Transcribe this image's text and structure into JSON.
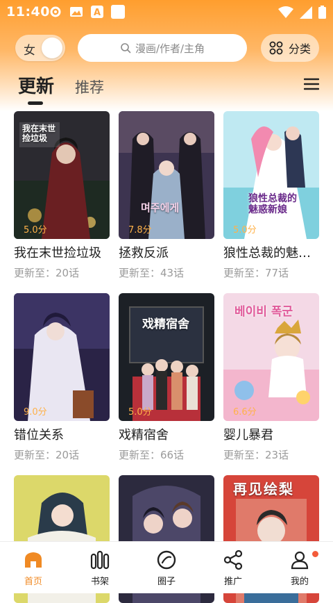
{
  "status_bar": {
    "time": "11:40",
    "icons": [
      "gear-icon",
      "image-icon",
      "a-letter-icon",
      "square-icon"
    ],
    "right_icons": [
      "wifi-icon",
      "cellular-icon",
      "battery-icon"
    ]
  },
  "header": {
    "gender_toggle_label": "女",
    "search_placeholder": "漫画/作者/主角",
    "category_label": "分类",
    "accent_color": "#ff9e2e"
  },
  "tabs": [
    {
      "label": "更新",
      "active": true
    },
    {
      "label": "推荐",
      "active": false
    }
  ],
  "comics": [
    {
      "title": "我在末世捡垃圾",
      "score": "5.0分",
      "update": "更新至：20话",
      "cover_text": "我在末世捡垃圾"
    },
    {
      "title": "拯救反派",
      "score": "7.8分",
      "update": "更新至：43话",
      "cover_text": "며주에게"
    },
    {
      "title": "狼性总裁的魅…",
      "score": "5.0分",
      "update": "更新至：77话",
      "cover_text": "狼性总裁的魅惑新娘"
    },
    {
      "title": "错位关系",
      "score": "9.0分",
      "update": "更新至：20话",
      "cover_text": ""
    },
    {
      "title": "戏精宿舍",
      "score": "5.0分",
      "update": "更新至：66话",
      "cover_text": "戏精宿舍"
    },
    {
      "title": "婴儿暴君",
      "score": "6.6分",
      "update": "更新至：23话",
      "cover_text": "베이비 폭군"
    },
    {
      "title": "",
      "score": "",
      "update": "",
      "cover_text": ""
    },
    {
      "title": "",
      "score": "",
      "update": "",
      "cover_text": ""
    },
    {
      "title": "",
      "score": "",
      "update": "",
      "cover_text": "再见绘梨"
    }
  ],
  "bottom_nav": [
    {
      "label": "首页",
      "icon": "home-icon",
      "active": true
    },
    {
      "label": "书架",
      "icon": "bookshelf-icon",
      "active": false
    },
    {
      "label": "圈子",
      "icon": "circle-icon",
      "active": false
    },
    {
      "label": "推广",
      "icon": "share-icon",
      "active": false
    },
    {
      "label": "我的",
      "icon": "profile-icon",
      "active": false
    }
  ]
}
